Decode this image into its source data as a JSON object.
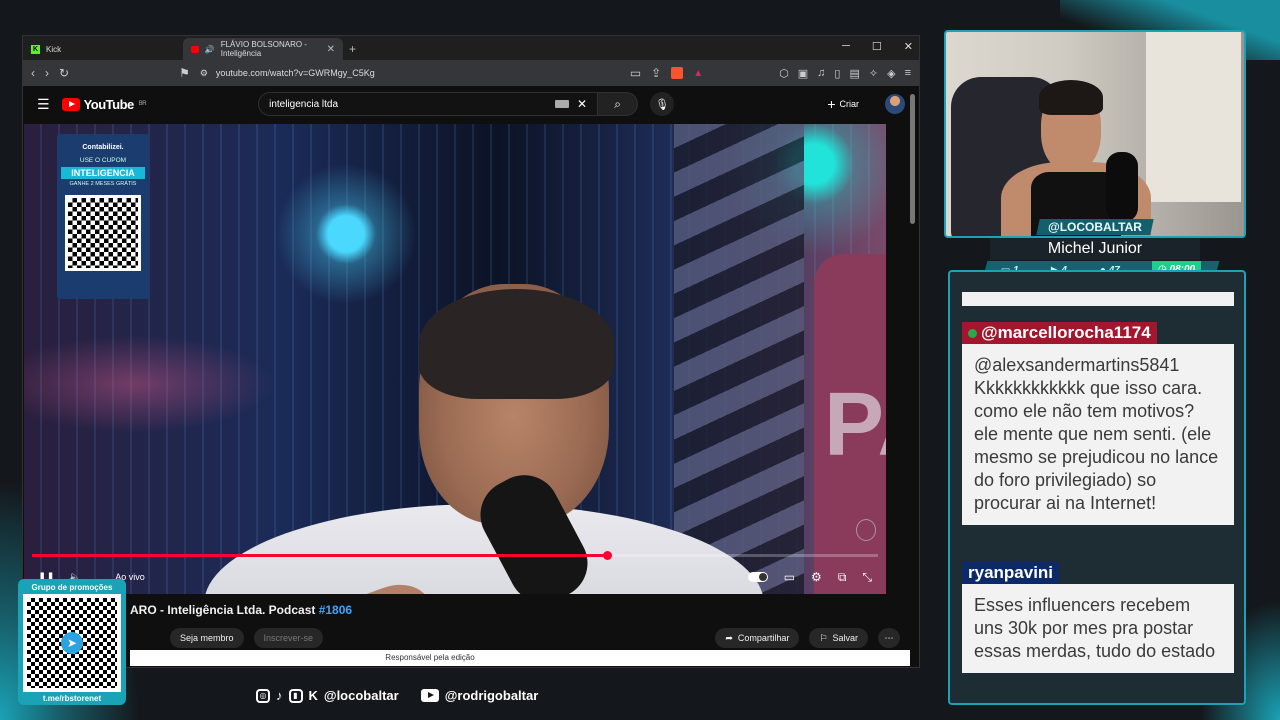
{
  "browser": {
    "tabs": [
      {
        "label": "Kick"
      },
      {
        "label": "FLÁVIO BOLSONARO - Inteligência"
      }
    ],
    "url": "youtube.com/watch?v=GWRMgy_C5Kg"
  },
  "youtube": {
    "logo": "YouTube",
    "region": "BR",
    "search_query": "inteligencia ltda",
    "create_label": "Criar",
    "promo": {
      "brand": "Contabilizei.",
      "use_coupon": "USE O CUPOM",
      "code": "INTELIGENCIA",
      "gift": "GANHE 2 MESES GRÁTIS"
    },
    "player": {
      "live_label": "Ao vivo",
      "progress": 0.68
    },
    "title_prefix": "ARO - Inteligência Ltda. Podcast ",
    "title_tag": "#1806",
    "join_label": "Seja membro",
    "subscribe_label": "Inscrever-se",
    "share_label": "Compartilhar",
    "save_label": "Salvar",
    "notice": "Responsável pela edição"
  },
  "overlay": {
    "promo_group": "Grupo de promoções",
    "promo_url": "t.me/rbstorenet",
    "kick_handle": "@locobaltar",
    "yt_handle": "@rodrigobaltar"
  },
  "streamer": {
    "handle": "@LOCOBALTAR",
    "name": "Michel Junior",
    "stats": {
      "s1": "1",
      "s2": "4",
      "s3": "47",
      "time": "08:00"
    }
  },
  "chat": {
    "messages": [
      {
        "user": "@marcellorocha1174",
        "text": "@alexsandermartins5841 Kkkkkkkkkkkk que isso cara. como ele não tem motivos? ele mente que nem senti. (ele mesmo se prejudicou no lance do foro privilegiado) so procurar ai na Internet!"
      },
      {
        "user": "ryanpavini",
        "text": "Esses influencers recebem uns 30k por mes pra postar essas merdas, tudo do estado"
      }
    ]
  },
  "colors": {
    "accent": "#1aa3b6",
    "yt_red": "#ff0000",
    "chat_red": "#a3162e",
    "chat_blue": "#0c2a6a"
  }
}
